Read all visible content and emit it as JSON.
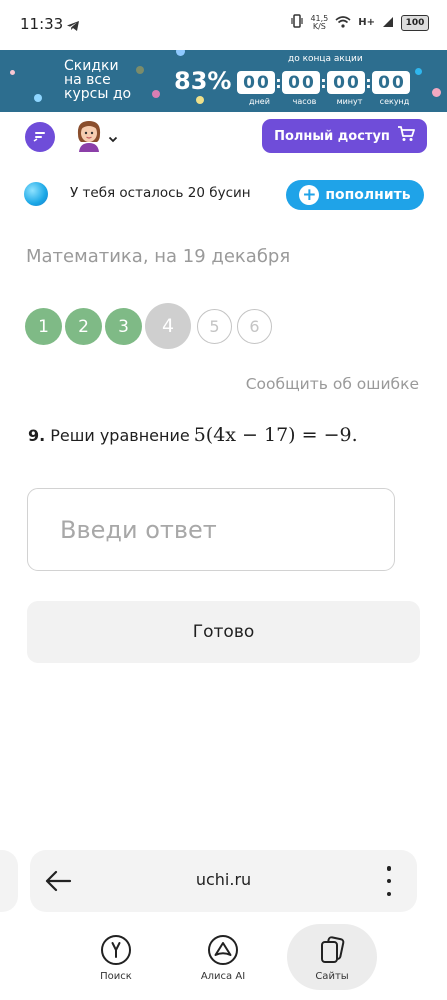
{
  "status_bar": {
    "time": "11:33",
    "speed_value": "41,5",
    "speed_unit": "K/S",
    "network": "H+",
    "battery": "100"
  },
  "promo": {
    "text_line1": "Скидки",
    "text_line2": "на все",
    "text_line3": "курсы до",
    "discount": "83%",
    "until_label": "до конца акции",
    "timer": [
      {
        "digits": [
          "0",
          "0"
        ],
        "unit": "дней"
      },
      {
        "digits": [
          "0",
          "0"
        ],
        "unit": "часов"
      },
      {
        "digits": [
          "0",
          "0"
        ],
        "unit": "минут"
      },
      {
        "digits": [
          "0",
          "0"
        ],
        "unit": "секунд"
      }
    ],
    "colors": {
      "background": "#2d6e8f"
    }
  },
  "header": {
    "chat_icon": "chat-bubble-icon",
    "avatar_icon": "girl-avatar-icon",
    "full_access_label": "Полный доступ",
    "cart_icon": "cart-icon",
    "accent": "#6f4dd9"
  },
  "beads": {
    "text": "У тебя осталось 20 бусин",
    "refill_label": "пополнить",
    "accent": "#1fa3e8"
  },
  "lesson": {
    "title": "Математика, на 19 декабря",
    "steps": [
      {
        "label": "1",
        "state": "done"
      },
      {
        "label": "2",
        "state": "done"
      },
      {
        "label": "3",
        "state": "done"
      },
      {
        "label": "4",
        "state": "current"
      },
      {
        "label": "5",
        "state": "todo"
      },
      {
        "label": "6",
        "state": "todo"
      }
    ],
    "report_link": "Сообщить об ошибке"
  },
  "task": {
    "number": "9.",
    "text": "Реши уравнение",
    "math": "5(4x − 17) = −9."
  },
  "answer": {
    "placeholder": "Введи ответ",
    "value": ""
  },
  "done_label": "Готово",
  "browser": {
    "url": "uchi.ru",
    "nav": [
      {
        "label": "Поиск",
        "icon": "yandex-search-icon"
      },
      {
        "label": "Алиса AI",
        "icon": "alice-icon"
      },
      {
        "label": "Сайты",
        "icon": "tabs-icon"
      }
    ]
  }
}
